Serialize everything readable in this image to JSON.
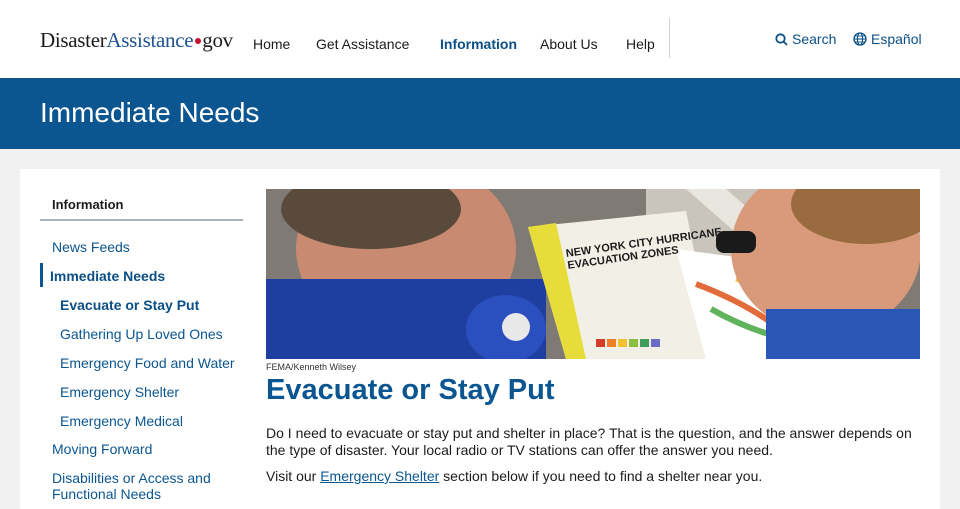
{
  "header": {
    "logo_left": "Disaster",
    "logo_mid": "Assistance",
    "logo_right": "gov",
    "nav": [
      "Home",
      "Get Assistance",
      "Information",
      "About Us",
      "Help"
    ],
    "search_label": "Search",
    "language_label": "Español"
  },
  "banner": {
    "title": "Immediate Needs"
  },
  "sidebar": {
    "heading": "Information",
    "items": [
      {
        "label": "News Feeds"
      },
      {
        "label": "Immediate Needs"
      },
      {
        "label": "Evacuate or Stay Put"
      },
      {
        "label": "Gathering Up Loved Ones"
      },
      {
        "label": "Emergency Food and Water"
      },
      {
        "label": "Emergency Shelter"
      },
      {
        "label": "Emergency Medical"
      },
      {
        "label": "Moving Forward"
      },
      {
        "label": "Disabilities or Access and"
      },
      {
        "label": "Functional Needs"
      }
    ]
  },
  "main": {
    "hero_map_title_1": "NEW YORK CITY HURRICANE",
    "hero_map_title_2": "EVACUATION ZONES",
    "photo_credit": "FEMA/Kenneth Wilsey",
    "title": "Evacuate or Stay Put",
    "para1": "Do I need to evacuate or stay put and shelter in place? That is the question, and the answer depends on the type of disaster. Your local radio or TV stations can offer the answer you need.",
    "para2_before": "Visit our ",
    "para2_link": "Emergency Shelter",
    "para2_after": " section below if you need to find a shelter near you."
  },
  "colors": {
    "brand_blue": "#0b5691",
    "logo_red": "#c8102e",
    "page_bg": "#f1f1f1"
  }
}
